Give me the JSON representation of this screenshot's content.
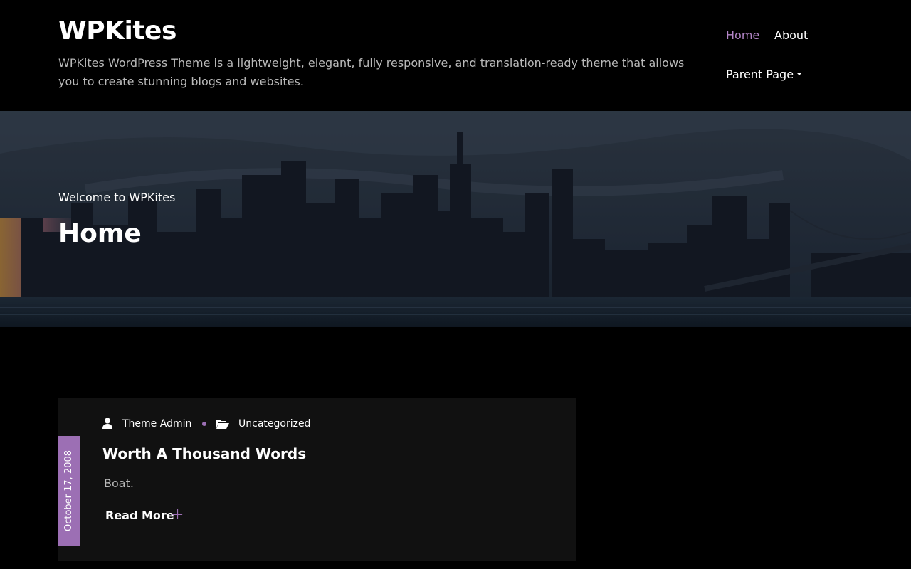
{
  "site": {
    "title": "WPKites",
    "description": "WPKites WordPress Theme is a lightweight, elegant, fully responsive, and translation-ready theme that allows you to create stunning blogs and websites."
  },
  "nav": {
    "items": [
      {
        "label": "Home"
      },
      {
        "label": "About"
      },
      {
        "label": "Parent Page"
      }
    ]
  },
  "hero": {
    "subtitle": "Welcome to WPKites",
    "title": "Home"
  },
  "post": {
    "date": "October 17, 2008",
    "author": "Theme Admin",
    "category": "Uncategorized",
    "title": "Worth A Thousand Words",
    "excerpt": "Boat.",
    "read_more": "Read More",
    "read_more_icon": "+"
  },
  "colors": {
    "accent": "#9c6fb4",
    "nav_active": "#b486c8",
    "background": "#000000",
    "card": "#111111"
  }
}
